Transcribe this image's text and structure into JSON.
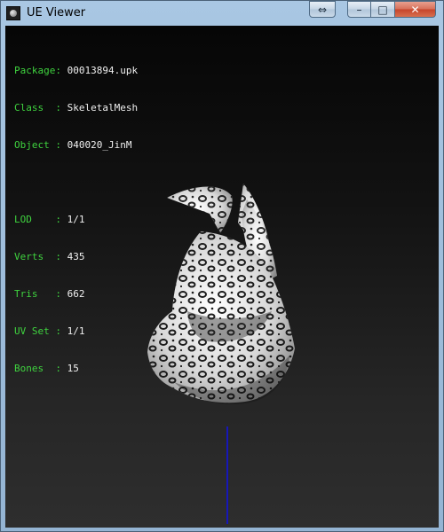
{
  "window": {
    "title": "UE Viewer",
    "controls": {
      "swap": "⇔",
      "minimize": "–",
      "maximize": "□",
      "close": "✕"
    }
  },
  "info": {
    "package": {
      "label": "Package:",
      "value": "00013894.upk"
    },
    "class": {
      "label": "Class  :",
      "value": "SkeletalMesh"
    },
    "object": {
      "label": "Object :",
      "value": "040020_JinM"
    },
    "lod": {
      "label": "LOD    :",
      "value": "1/1"
    },
    "verts": {
      "label": "Verts  :",
      "value": "435"
    },
    "tris": {
      "label": "Tris   :",
      "value": "662"
    },
    "uvset": {
      "label": "UV Set :",
      "value": "1/1"
    },
    "bones": {
      "label": "Bones  :",
      "value": "15"
    }
  },
  "colors": {
    "label_green": "#3fd33f",
    "value_white": "#f0f0f0",
    "axis_blue": "#1717b9"
  },
  "icons": {
    "app": "app-icon",
    "mesh": "leopard-print-mesh"
  }
}
